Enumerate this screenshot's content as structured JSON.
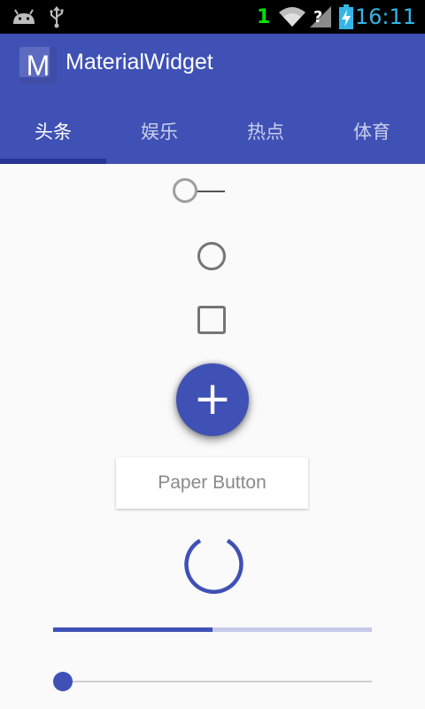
{
  "status_bar": {
    "time": "16:11",
    "sim_badge": "1",
    "icons": [
      "android-debug-icon",
      "usb-icon",
      "wifi-icon",
      "no-signal-icon",
      "battery-charging-icon"
    ]
  },
  "app_bar": {
    "logo_letter": "M",
    "title": "MaterialWidget",
    "color": "#3f51b5"
  },
  "tabs": [
    {
      "label": "头条",
      "active": true
    },
    {
      "label": "娱乐",
      "active": false
    },
    {
      "label": "热点",
      "active": false
    },
    {
      "label": "体育",
      "active": false
    }
  ],
  "widgets": {
    "switch": {
      "checked": false
    },
    "radio": {
      "checked": false
    },
    "checkbox": {
      "checked": false
    },
    "fab": {
      "icon": "plus-icon",
      "symbol": "+"
    },
    "paper_button": {
      "label": "Paper Button"
    },
    "progress": {
      "fraction": 0.5
    },
    "slider": {
      "value": 0.0
    }
  },
  "colors": {
    "primary": "#3f51b5",
    "primary_dark": "#283593",
    "clock": "#33b5e5"
  }
}
